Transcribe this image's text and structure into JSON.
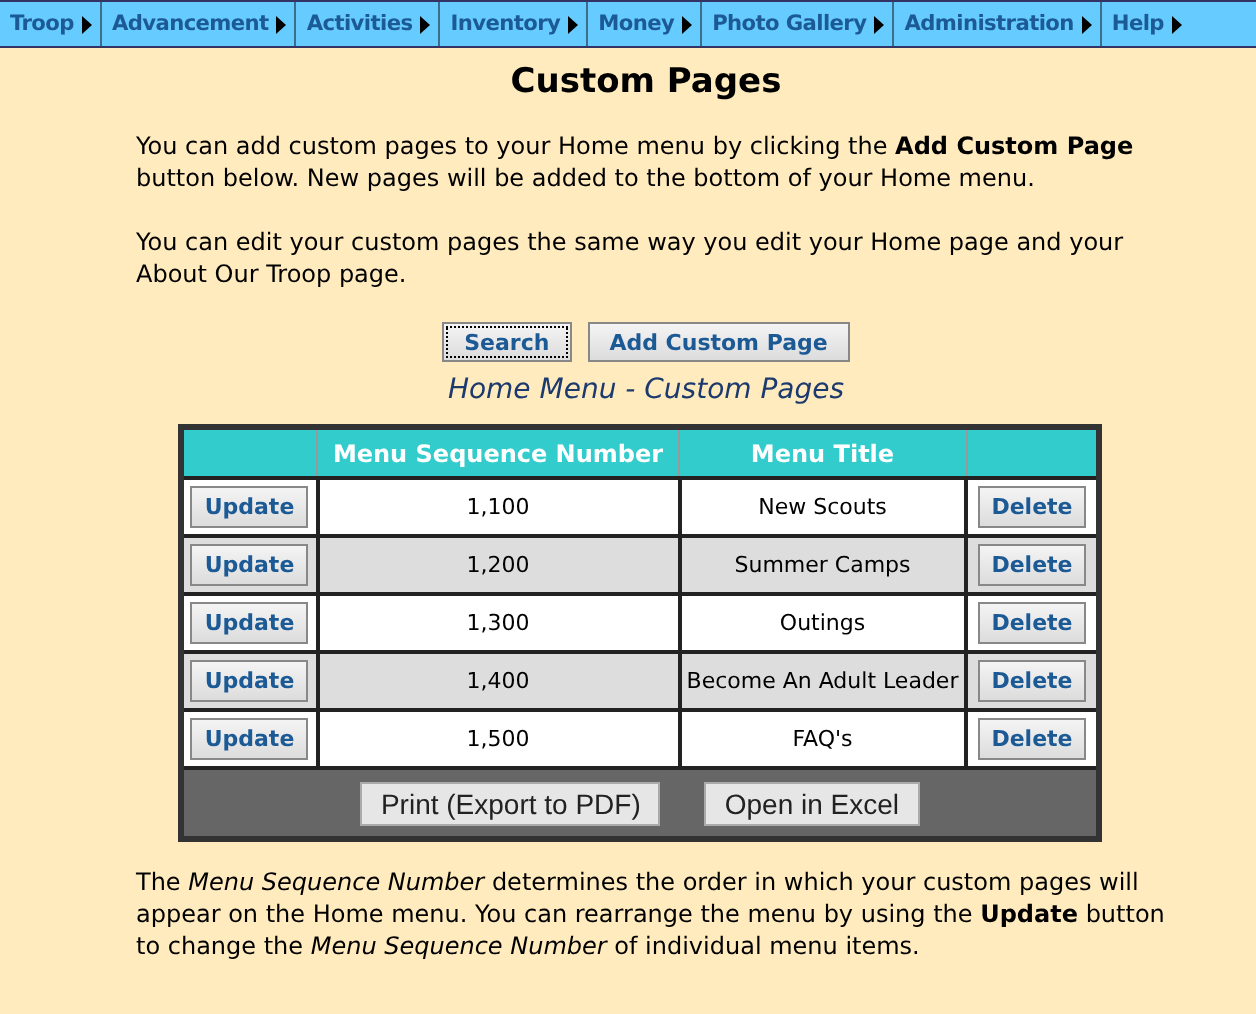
{
  "menu": [
    {
      "label": "Troop"
    },
    {
      "label": "Advancement"
    },
    {
      "label": "Activities"
    },
    {
      "label": "Inventory"
    },
    {
      "label": "Money"
    },
    {
      "label": "Photo Gallery"
    },
    {
      "label": "Administration"
    },
    {
      "label": "Help"
    }
  ],
  "title": "Custom Pages",
  "intro": [
    "You can add custom pages to your Home menu by clicking the **Add Custom Page** button below. New pages will be added to the bottom of your Home menu.",
    "You can edit your custom pages the same way you edit your Home page and your About Our Troop page."
  ],
  "actions": [
    {
      "label": "Search",
      "focused": true
    },
    {
      "label": "Add Custom Page",
      "focused": false
    }
  ],
  "table": {
    "caption": "Home Menu - Custom Pages",
    "columns": [
      "Menu Sequence Number",
      "Menu Title"
    ],
    "rows": [
      {
        "update": "Update",
        "sequence": "1,100",
        "title": "New Scouts",
        "delete": "Delete"
      },
      {
        "update": "Update",
        "sequence": "1,200",
        "title": "Summer Camps",
        "delete": "Delete"
      },
      {
        "update": "Update",
        "sequence": "1,300",
        "title": "Outings",
        "delete": "Delete"
      },
      {
        "update": "Update",
        "sequence": "1,400",
        "title": "Become An Adult Leader",
        "delete": "Delete"
      },
      {
        "update": "Update",
        "sequence": "1,500",
        "title": "FAQ's",
        "delete": "Delete"
      }
    ],
    "footer_buttons": [
      "Print (Export to PDF)",
      "Open in Excel"
    ]
  },
  "note": "The *Menu Sequence Number* determines the order in which your custom pages will appear on the Home menu. You can rearrange the menu by using the **Update** button to change the *Menu Sequence Number* of individual menu items."
}
